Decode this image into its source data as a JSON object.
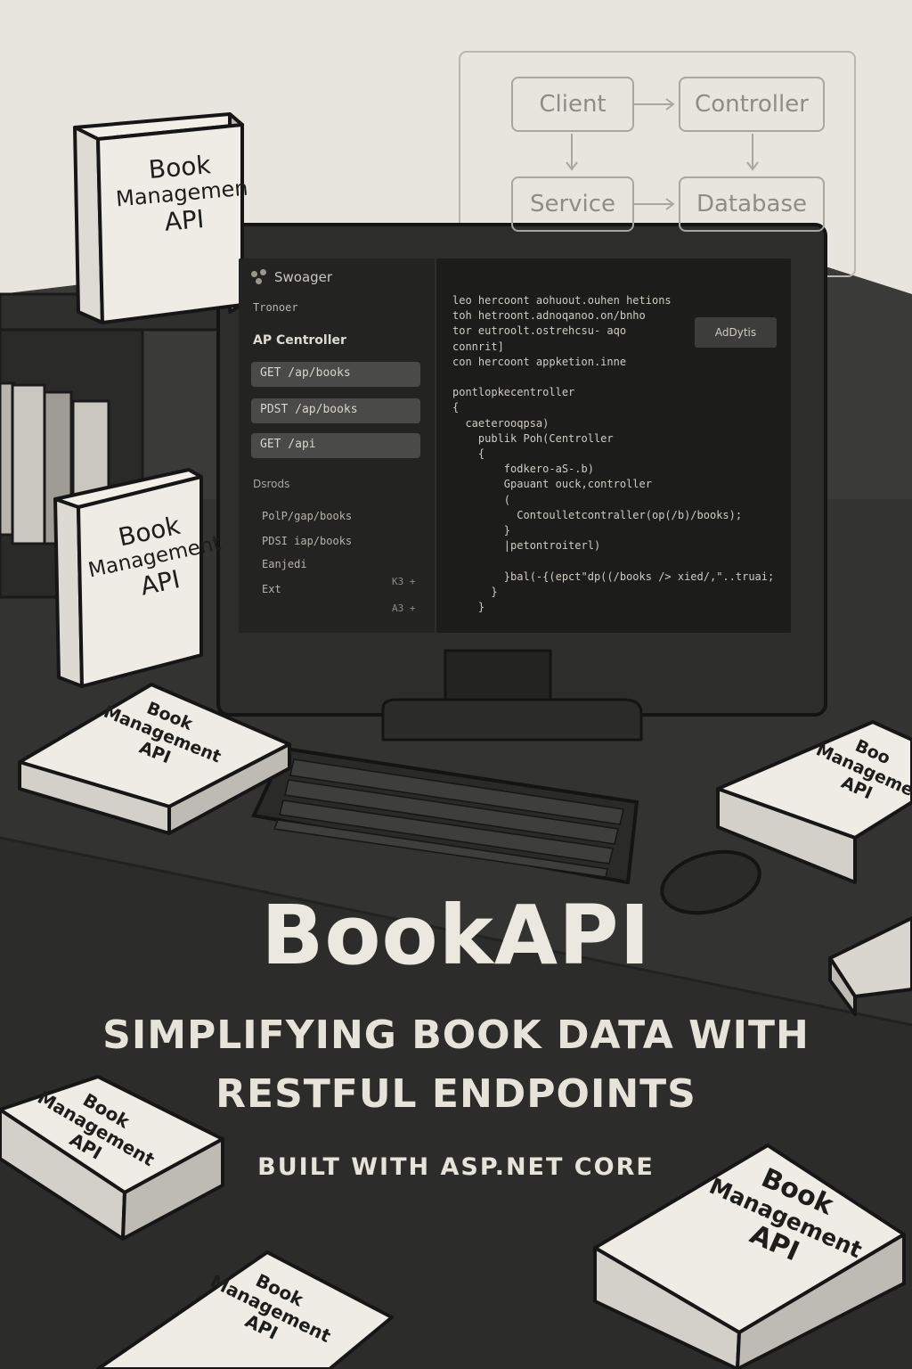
{
  "diagram": {
    "client": "Client",
    "controller": "Controller",
    "service": "Service",
    "database": "Database"
  },
  "books": {
    "shelf_top": [
      "Book",
      "Managemen",
      "API"
    ],
    "shelf_front": [
      "Book",
      "Management",
      "API"
    ],
    "desk": [
      "Book",
      "Management",
      "API"
    ],
    "desk_right": [
      "Boo",
      "Manageme",
      "API"
    ]
  },
  "screen": {
    "app_name": "Swoager",
    "sidebar_top": "Tronoer",
    "section_title": "AP Centroller",
    "endpoints": [
      "GET  /ap/books",
      "PDST  /ap/books",
      "GET  /api"
    ],
    "section2_title": "Dsrods",
    "links": [
      "PolP/gap/books",
      "PDSI  iap/books",
      "Eanjedi",
      "Ext"
    ],
    "shortcuts": [
      "K3 +",
      "A3 +"
    ],
    "action_button": "AdDytis",
    "code_lines": [
      "leo hercoont aohuout.ouhen hetions",
      "toh hetroont.adnoqanoo.on/bnho",
      "tor eutroolt.ostrehcsu- aqo",
      "connrit]",
      "con hercoont appketion.inne",
      "",
      "pontlopkecentroller",
      "{",
      "  caeterooqpsa)",
      "    publik Poh(Centroller",
      "    {",
      "        fodkero-aS-.b)",
      "        Gpauant ouck,controller",
      "        (",
      "          Contoulletcontraller(op(/b)/books);",
      "        }",
      "        |petontroiterl)",
      "",
      "        }bal(-{(epct\"dp((/books /> xied/,\"..truai;",
      "      }",
      "    }"
    ]
  },
  "hero": {
    "title": "BookAPI",
    "subtitle_line1": "SIMPLIFYING BOOK DATA WITH",
    "subtitle_line2": "RESTFUL ENDPOINTS",
    "built_with": "BUILT WITH ASP.NET CORE"
  }
}
